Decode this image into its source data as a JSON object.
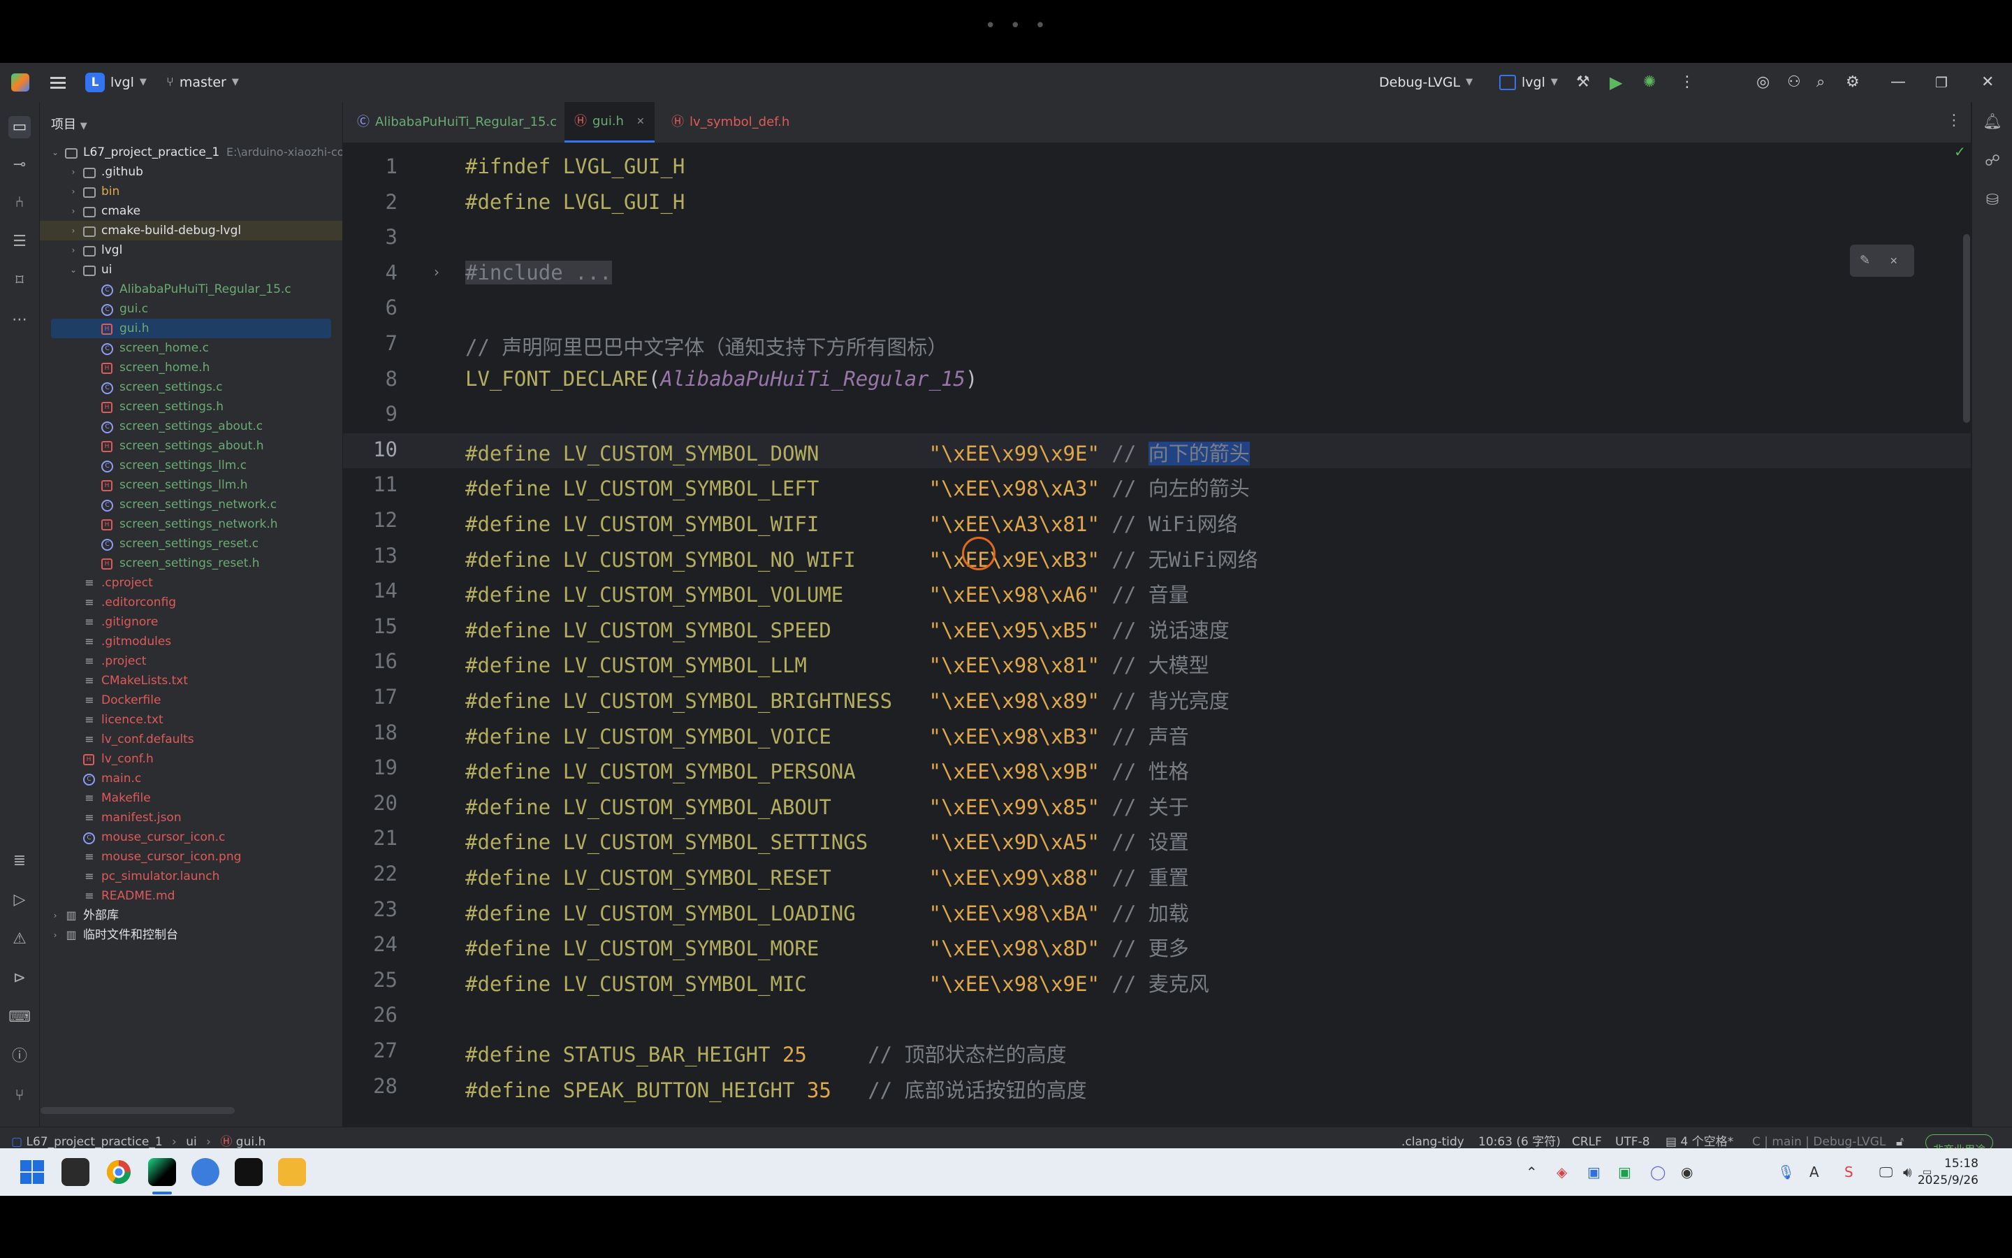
{
  "titlebar": {
    "project_badge": "L",
    "project_name": "lvgl",
    "branch": "master",
    "run_config": "Debug-LVGL",
    "target": "lvgl"
  },
  "project_panel": {
    "header": "项目",
    "tree": [
      {
        "label": "L67_project_practice_1",
        "extra": "E:\\arduino-xiaozhi-co",
        "type": "folder",
        "depth": 0,
        "expanded": true
      },
      {
        "label": ".github",
        "type": "folder",
        "depth": 1
      },
      {
        "label": "bin",
        "type": "folder",
        "depth": 1,
        "color": "orange"
      },
      {
        "label": "cmake",
        "type": "folder",
        "depth": 1
      },
      {
        "label": "cmake-build-debug-lvgl",
        "type": "folder",
        "depth": 1,
        "highlight": true
      },
      {
        "label": "lvgl",
        "type": "folder",
        "depth": 1
      },
      {
        "label": "ui",
        "type": "folder",
        "depth": 1,
        "expanded": true
      },
      {
        "label": "AlibabaPuHuiTi_Regular_15.c",
        "type": "c",
        "depth": 2,
        "color": "green"
      },
      {
        "label": "gui.c",
        "type": "c",
        "depth": 2,
        "color": "green"
      },
      {
        "label": "gui.h",
        "type": "h",
        "depth": 2,
        "color": "green",
        "selected": true
      },
      {
        "label": "screen_home.c",
        "type": "c",
        "depth": 2,
        "color": "green"
      },
      {
        "label": "screen_home.h",
        "type": "h",
        "depth": 2,
        "color": "green"
      },
      {
        "label": "screen_settings.c",
        "type": "c",
        "depth": 2,
        "color": "green"
      },
      {
        "label": "screen_settings.h",
        "type": "h",
        "depth": 2,
        "color": "green"
      },
      {
        "label": "screen_settings_about.c",
        "type": "c",
        "depth": 2,
        "color": "green"
      },
      {
        "label": "screen_settings_about.h",
        "type": "h",
        "depth": 2,
        "color": "green"
      },
      {
        "label": "screen_settings_llm.c",
        "type": "c",
        "depth": 2,
        "color": "green"
      },
      {
        "label": "screen_settings_llm.h",
        "type": "h",
        "depth": 2,
        "color": "green"
      },
      {
        "label": "screen_settings_network.c",
        "type": "c",
        "depth": 2,
        "color": "green"
      },
      {
        "label": "screen_settings_network.h",
        "type": "h",
        "depth": 2,
        "color": "green"
      },
      {
        "label": "screen_settings_reset.c",
        "type": "c",
        "depth": 2,
        "color": "green"
      },
      {
        "label": "screen_settings_reset.h",
        "type": "h",
        "depth": 2,
        "color": "green"
      },
      {
        "label": ".cproject",
        "type": "t",
        "depth": 1,
        "color": "red"
      },
      {
        "label": ".editorconfig",
        "type": "t",
        "depth": 1,
        "color": "red"
      },
      {
        "label": ".gitignore",
        "type": "t",
        "depth": 1,
        "color": "red"
      },
      {
        "label": ".gitmodules",
        "type": "t",
        "depth": 1,
        "color": "red"
      },
      {
        "label": ".project",
        "type": "t",
        "depth": 1,
        "color": "red"
      },
      {
        "label": "CMakeLists.txt",
        "type": "t",
        "depth": 1,
        "color": "red"
      },
      {
        "label": "Dockerfile",
        "type": "t",
        "depth": 1,
        "color": "red"
      },
      {
        "label": "licence.txt",
        "type": "t",
        "depth": 1,
        "color": "red"
      },
      {
        "label": "lv_conf.defaults",
        "type": "t",
        "depth": 1,
        "color": "red"
      },
      {
        "label": "lv_conf.h",
        "type": "h",
        "depth": 1,
        "color": "red"
      },
      {
        "label": "main.c",
        "type": "c",
        "depth": 1,
        "color": "red"
      },
      {
        "label": "Makefile",
        "type": "t",
        "depth": 1,
        "color": "red"
      },
      {
        "label": "manifest.json",
        "type": "t",
        "depth": 1,
        "color": "red"
      },
      {
        "label": "mouse_cursor_icon.c",
        "type": "c",
        "depth": 1,
        "color": "red"
      },
      {
        "label": "mouse_cursor_icon.png",
        "type": "t",
        "depth": 1,
        "color": "red"
      },
      {
        "label": "pc_simulator.launch",
        "type": "t",
        "depth": 1,
        "color": "red"
      },
      {
        "label": "README.md",
        "type": "t",
        "depth": 1,
        "color": "red"
      },
      {
        "label": "外部库",
        "type": "lib",
        "depth": 0
      },
      {
        "label": "临时文件和控制台",
        "type": "lib",
        "depth": 0
      }
    ]
  },
  "tabs": [
    {
      "label": "AlibabaPuHuiTi_Regular_15.c",
      "type": "c",
      "active": false
    },
    {
      "label": "gui.h",
      "type": "h",
      "active": true
    },
    {
      "label": "lv_symbol_def.h",
      "type": "h",
      "active": false
    }
  ],
  "editor": {
    "lines": [
      {
        "n": "1",
        "parts": [
          [
            "kw",
            "#ifndef "
          ],
          [
            "mac",
            "LVGL_GUI_H"
          ]
        ]
      },
      {
        "n": "2",
        "parts": [
          [
            "kw",
            "#define "
          ],
          [
            "mac",
            "LVGL_GUI_H"
          ]
        ]
      },
      {
        "n": "3",
        "parts": []
      },
      {
        "n": "4",
        "fold": true,
        "parts": [
          [
            "fold",
            "#include ..."
          ]
        ]
      },
      {
        "n": "6",
        "parts": []
      },
      {
        "n": "7",
        "parts": [
          [
            "cmt",
            "// 声明阿里巴巴中文字体（通知支持下方所有图标）"
          ]
        ]
      },
      {
        "n": "8",
        "parts": [
          [
            "mac",
            "LV_FONT_DECLARE"
          ],
          [
            "plain",
            "("
          ],
          [
            "ital",
            "AlibabaPuHuiTi_Regular_15"
          ],
          [
            "plain",
            ")"
          ]
        ]
      },
      {
        "n": "9",
        "parts": []
      },
      {
        "n": "10",
        "current": true,
        "parts": [
          [
            "kw",
            "#define "
          ],
          [
            "mac",
            "LV_CUSTOM_SYMBOL_DOWN         "
          ],
          [
            "str",
            "\"\\xEE\\x99\\x9E\""
          ],
          [
            "cmt",
            " // "
          ],
          [
            "sel",
            "向下的箭头"
          ]
        ]
      },
      {
        "n": "11",
        "parts": [
          [
            "kw",
            "#define "
          ],
          [
            "mac",
            "LV_CUSTOM_SYMBOL_LEFT         "
          ],
          [
            "str",
            "\"\\xEE\\x98\\xA3\""
          ],
          [
            "cmt",
            " // 向左的箭头"
          ]
        ]
      },
      {
        "n": "12",
        "parts": [
          [
            "kw",
            "#define "
          ],
          [
            "mac",
            "LV_CUSTOM_SYMBOL_WIFI         "
          ],
          [
            "str",
            "\"\\xEE\\xA3\\x81\""
          ],
          [
            "cmt",
            " // WiFi网络"
          ]
        ]
      },
      {
        "n": "13",
        "parts": [
          [
            "kw",
            "#define "
          ],
          [
            "mac",
            "LV_CUSTOM_SYMBOL_NO_WIFI      "
          ],
          [
            "str",
            "\"\\xEE\\x9E\\xB3\""
          ],
          [
            "cmt",
            " // 无WiFi网络"
          ]
        ]
      },
      {
        "n": "14",
        "parts": [
          [
            "kw",
            "#define "
          ],
          [
            "mac",
            "LV_CUSTOM_SYMBOL_VOLUME       "
          ],
          [
            "str",
            "\"\\xEE\\x98\\xA6\""
          ],
          [
            "cmt",
            " // 音量"
          ]
        ]
      },
      {
        "n": "15",
        "parts": [
          [
            "kw",
            "#define "
          ],
          [
            "mac",
            "LV_CUSTOM_SYMBOL_SPEED        "
          ],
          [
            "str",
            "\"\\xEE\\x95\\xB5\""
          ],
          [
            "cmt",
            " // 说话速度"
          ]
        ]
      },
      {
        "n": "16",
        "parts": [
          [
            "kw",
            "#define "
          ],
          [
            "mac",
            "LV_CUSTOM_SYMBOL_LLM          "
          ],
          [
            "str",
            "\"\\xEE\\x98\\x81\""
          ],
          [
            "cmt",
            " // 大模型"
          ]
        ]
      },
      {
        "n": "17",
        "parts": [
          [
            "kw",
            "#define "
          ],
          [
            "mac",
            "LV_CUSTOM_SYMBOL_BRIGHTNESS   "
          ],
          [
            "str",
            "\"\\xEE\\x98\\x89\""
          ],
          [
            "cmt",
            " // 背光亮度"
          ]
        ]
      },
      {
        "n": "18",
        "parts": [
          [
            "kw",
            "#define "
          ],
          [
            "mac",
            "LV_CUSTOM_SYMBOL_VOICE        "
          ],
          [
            "str",
            "\"\\xEE\\x98\\xB3\""
          ],
          [
            "cmt",
            " // 声音"
          ]
        ]
      },
      {
        "n": "19",
        "parts": [
          [
            "kw",
            "#define "
          ],
          [
            "mac",
            "LV_CUSTOM_SYMBOL_PERSONA      "
          ],
          [
            "str",
            "\"\\xEE\\x98\\x9B\""
          ],
          [
            "cmt",
            " // 性格"
          ]
        ]
      },
      {
        "n": "20",
        "parts": [
          [
            "kw",
            "#define "
          ],
          [
            "mac",
            "LV_CUSTOM_SYMBOL_ABOUT        "
          ],
          [
            "str",
            "\"\\xEE\\x99\\x85\""
          ],
          [
            "cmt",
            " // 关于"
          ]
        ]
      },
      {
        "n": "21",
        "parts": [
          [
            "kw",
            "#define "
          ],
          [
            "mac",
            "LV_CUSTOM_SYMBOL_SETTINGS     "
          ],
          [
            "str",
            "\"\\xEE\\x9D\\xA5\""
          ],
          [
            "cmt",
            " // 设置"
          ]
        ]
      },
      {
        "n": "22",
        "parts": [
          [
            "kw",
            "#define "
          ],
          [
            "mac",
            "LV_CUSTOM_SYMBOL_RESET        "
          ],
          [
            "str",
            "\"\\xEE\\x99\\x88\""
          ],
          [
            "cmt",
            " // 重置"
          ]
        ]
      },
      {
        "n": "23",
        "parts": [
          [
            "kw",
            "#define "
          ],
          [
            "mac",
            "LV_CUSTOM_SYMBOL_LOADING      "
          ],
          [
            "str",
            "\"\\xEE\\x98\\xBA\""
          ],
          [
            "cmt",
            " // 加载"
          ]
        ]
      },
      {
        "n": "24",
        "parts": [
          [
            "kw",
            "#define "
          ],
          [
            "mac",
            "LV_CUSTOM_SYMBOL_MORE         "
          ],
          [
            "str",
            "\"\\xEE\\x98\\x8D\""
          ],
          [
            "cmt",
            " // 更多"
          ]
        ]
      },
      {
        "n": "25",
        "parts": [
          [
            "kw",
            "#define "
          ],
          [
            "mac",
            "LV_CUSTOM_SYMBOL_MIC          "
          ],
          [
            "str",
            "\"\\xEE\\x98\\x9E\""
          ],
          [
            "cmt",
            " // 麦克风"
          ]
        ]
      },
      {
        "n": "26",
        "parts": []
      },
      {
        "n": "27",
        "parts": [
          [
            "kw",
            "#define "
          ],
          [
            "mac",
            "STATUS_BAR_HEIGHT "
          ],
          [
            "str",
            "25"
          ],
          [
            "cmt",
            "     // 顶部状态栏的高度"
          ]
        ]
      },
      {
        "n": "28",
        "parts": [
          [
            "kw",
            "#define "
          ],
          [
            "mac",
            "SPEAK_BUTTON_HEIGHT "
          ],
          [
            "str",
            "35"
          ],
          [
            "cmt",
            "   // 底部说话按钮的高度"
          ]
        ]
      }
    ]
  },
  "statusbar": {
    "breadcrumb": [
      "L67_project_practice_1",
      "ui",
      "gui.h"
    ],
    "clang": ".clang-tidy",
    "position": "10:63 (6 字符)",
    "line_ending": "CRLF",
    "encoding": "UTF-8",
    "indent": "4 个空格*",
    "context": "C | main | Debug-LVGL",
    "license": "非商业用途"
  },
  "taskbar": {
    "time": "15:18",
    "date": "2025/9/26"
  },
  "colors": {
    "accent": "#3574f0",
    "keyword": "#b3ae60",
    "string": "#e0a84a",
    "comment": "#7a7e85",
    "cursor_ring": "#e06a1c"
  }
}
